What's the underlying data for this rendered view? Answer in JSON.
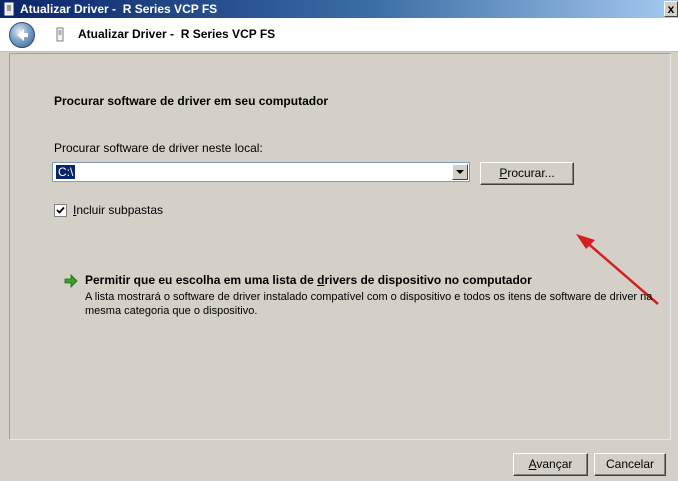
{
  "window": {
    "title": "Atualizar Driver -  R Series VCP FS",
    "close_glyph": "x"
  },
  "header": {
    "title": "Atualizar Driver -  R Series VCP FS"
  },
  "main": {
    "heading": "Procurar software de driver em seu computador",
    "location_label": "Procurar software de driver neste local:",
    "path_value": "C:\\",
    "browse_button": {
      "accel": "P",
      "rest": "rocurar..."
    },
    "include_subfolders": {
      "accel": "I",
      "rest": "ncluir subpastas",
      "checked": true
    },
    "pick_link": {
      "title_before": "Permitir que eu escolha em uma lista de ",
      "title_accel": "d",
      "title_after": "rivers de dispositivo no computador",
      "description": "A lista mostrará o software de driver instalado compatível com o dispositivo e todos os itens de software de driver na mesma categoria que o dispositivo."
    }
  },
  "footer": {
    "next_button": {
      "accel": "A",
      "rest": "vançar"
    },
    "cancel_button": "Cancelar"
  },
  "colors": {
    "titlebar": "#0a246a",
    "annotation": "#d42020",
    "link_arrow": "#3aa020"
  }
}
